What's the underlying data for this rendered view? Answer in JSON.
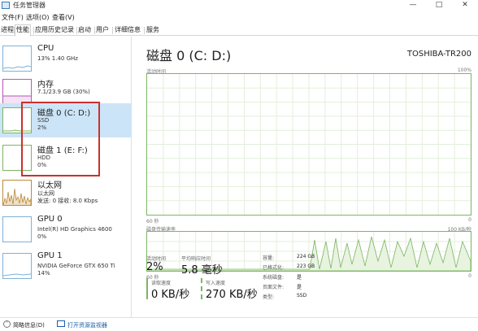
{
  "window": {
    "title": "任务管理器",
    "controls": [
      "—",
      "□",
      "✕"
    ]
  },
  "menu": [
    "文件(F)",
    "选项(O)",
    "查看(V)"
  ],
  "tabs": [
    "进程",
    "性能",
    "应用历史记录",
    "启动",
    "用户",
    "详细信息",
    "服务"
  ],
  "active_tab": "性能",
  "sidebar": {
    "items": [
      {
        "name": "CPU",
        "line1": "13%  1.40 GHz",
        "line2": ""
      },
      {
        "name": "内存",
        "line1": "7.1/23.9 GB (30%)",
        "line2": ""
      },
      {
        "name": "磁盘 0 (C: D:)",
        "line1": "SSD",
        "line2": "2%"
      },
      {
        "name": "磁盘 1 (E: F:)",
        "line1": "HDD",
        "line2": "0%"
      },
      {
        "name": "以太网",
        "line1": "以太网",
        "line2": "发送: 0 接收: 8.0 Kbps"
      },
      {
        "name": "GPU 0",
        "line1": "Intel(R) HD Graphics 4600",
        "line2": "0%"
      },
      {
        "name": "GPU 1",
        "line1": "NVIDIA GeForce GTX 650 Ti",
        "line2": "14%"
      }
    ],
    "selected_index": 2
  },
  "main": {
    "title": "磁盘 0 (C: D:)",
    "model": "TOSHIBA-TR200",
    "chart1": {
      "label": "活动时间",
      "max": "100%",
      "time_left": "60 秒",
      "time_right": "0"
    },
    "chart2": {
      "label": "磁盘传输速率",
      "max": "100 KB/秒",
      "time_left": "60 秒",
      "time_right": "0"
    },
    "stats": {
      "active_time_label": "活动时间",
      "active_time": "2%",
      "response_label": "平均响应时间",
      "response": "5.8 毫秒",
      "read_label": "读取速度",
      "read": "0 KB/秒",
      "write_label": "写入速度",
      "write": "270 KB/秒"
    },
    "details": [
      {
        "key": "容量:",
        "value": "224 GB"
      },
      {
        "key": "已格式化:",
        "value": "223 GB"
      },
      {
        "key": "系统磁盘:",
        "value": "是"
      },
      {
        "key": "页面文件:",
        "value": "是"
      },
      {
        "key": "类型:",
        "value": "SSD"
      }
    ]
  },
  "footer": {
    "brief": "简略信息(D)",
    "open_monitor": "打开资源监视器"
  },
  "colors": {
    "disk_green": "#7bb661",
    "selected": "#cce4f7",
    "highlight": "#c9312e",
    "cpu_blue": "#7fb0d8",
    "memory_purple": "#b45ab4",
    "network_orange": "#b98a3b"
  },
  "icons": {
    "app": "task-manager-icon",
    "brief": "chevron-up-icon",
    "monitor": "resource-monitor-icon"
  }
}
